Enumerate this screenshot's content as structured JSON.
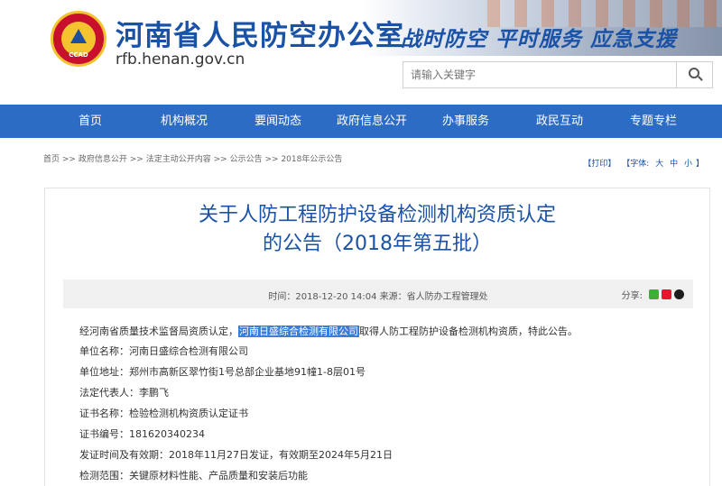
{
  "header": {
    "logo_text": "CCAD",
    "title": "河南省人民防空办公室",
    "url": "rfb.henan.gov.cn",
    "slogan": "战时防空 平时服务 应急支援",
    "search_placeholder": "请输入关键字"
  },
  "nav": {
    "items": [
      "首页",
      "机构概况",
      "要闻动态",
      "政府信息公开",
      "办事服务",
      "政民互动",
      "专题专栏"
    ]
  },
  "breadcrumb": {
    "items": [
      "首页",
      "政府信息公开",
      "法定主动公开内容",
      "公示公告",
      "2018年公示公告"
    ],
    "separator": ">>"
  },
  "tools": {
    "print": "【打印】",
    "font_label": "【字体:",
    "font_large": "大",
    "font_medium": "中",
    "font_small": "小",
    "close": "】"
  },
  "article": {
    "title_line1": "关于人防工程防护设备检测机构资质认定",
    "title_line2": "的公告（2018年第五批）",
    "meta": "时间：2018-12-20 14:04  来源：省人防办工程管理处",
    "share_label": "分享:",
    "intro_before": "经河南省质量技术监督局资质认定，",
    "intro_highlight": "河南日盛综合检测有限公司",
    "intro_after": "取得人防工程防护设备检测机构资质，特此公告。",
    "fields": [
      "单位名称：河南日盛综合检测有限公司",
      "单位地址：郑州市高新区翠竹街1号总部企业基地91幢1-8层01号",
      "法定代表人：李鹏飞",
      "证书名称：检验检测机构资质认定证书",
      "证书编号：181620340234",
      "发证时间及有效期：2018年11月27日发证，有效期至2024年5月21日",
      "检测范围：关键原材料性能、产品质量和安装后功能"
    ]
  },
  "colors": {
    "brand_blue": "#1a52a6",
    "nav_blue": "#2c6cc4",
    "highlight": "#3b7cd8"
  }
}
